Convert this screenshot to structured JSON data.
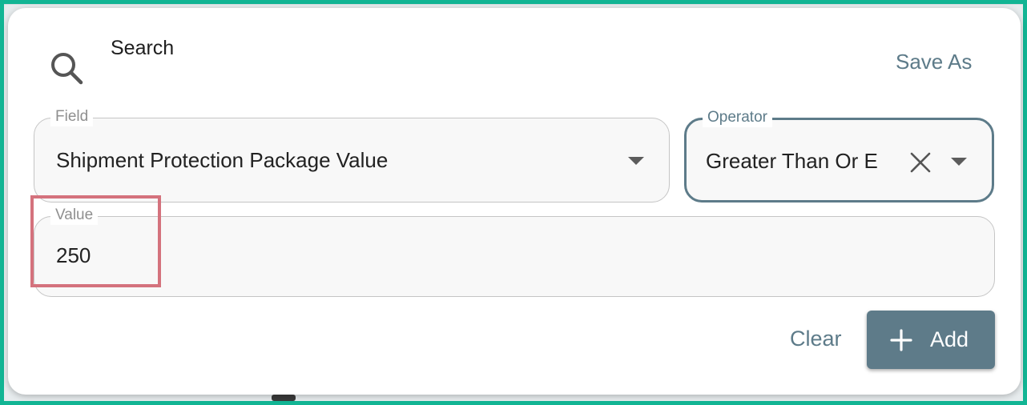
{
  "dialog": {
    "title": "Search",
    "search_icon": "search-icon",
    "save_as_label": "Save As"
  },
  "field": {
    "label": "Field",
    "value": "Shipment Protection Package Value",
    "arrow_icon": "chevron-down-icon"
  },
  "operator": {
    "label": "Operator",
    "value": "Greater Than Or E",
    "clear_icon": "close-icon",
    "arrow_icon": "chevron-down-icon"
  },
  "value": {
    "label": "Value",
    "value": "250"
  },
  "actions": {
    "clear_label": "Clear",
    "add_label": "Add",
    "add_icon": "plus-icon"
  },
  "colors": {
    "accent": "#5d7b89",
    "highlight": "#d4727d",
    "frame": "#12b594"
  }
}
